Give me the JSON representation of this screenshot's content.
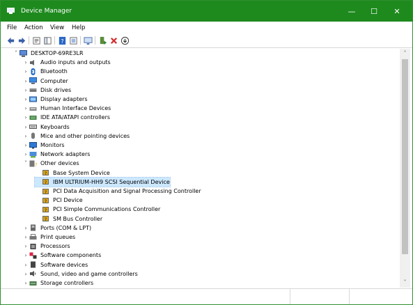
{
  "window": {
    "title": "Device Manager",
    "controls": {
      "minimize": "—",
      "maximize": "☐",
      "close": "✕"
    },
    "accent": "#1e8a1e"
  },
  "menu": [
    "File",
    "Action",
    "View",
    "Help"
  ],
  "toolbar": [
    {
      "name": "back-icon"
    },
    {
      "name": "forward-icon"
    },
    {
      "sep": true
    },
    {
      "name": "properties-icon"
    },
    {
      "name": "show-hide-console-tree-icon"
    },
    {
      "sep": true
    },
    {
      "name": "help-icon"
    },
    {
      "name": "view-icon"
    },
    {
      "sep": true
    },
    {
      "name": "scan-hardware-icon"
    },
    {
      "sep": true
    },
    {
      "name": "update-driver-icon"
    },
    {
      "name": "uninstall-device-icon"
    },
    {
      "name": "download-icon"
    }
  ],
  "tree": {
    "root": "DESKTOP-69RE3LR",
    "items": [
      {
        "label": "Audio inputs and outputs",
        "icon": "speaker-icon"
      },
      {
        "label": "Bluetooth",
        "icon": "bluetooth-icon"
      },
      {
        "label": "Computer",
        "icon": "computer-icon"
      },
      {
        "label": "Disk drives",
        "icon": "disk-drive-icon"
      },
      {
        "label": "Display adapters",
        "icon": "display-adapter-icon"
      },
      {
        "label": "Human Interface Devices",
        "icon": "hid-icon"
      },
      {
        "label": "IDE ATA/ATAPI controllers",
        "icon": "ide-controller-icon"
      },
      {
        "label": "Keyboards",
        "icon": "keyboard-icon"
      },
      {
        "label": "Mice and other pointing devices",
        "icon": "mouse-icon"
      },
      {
        "label": "Monitors",
        "icon": "monitor-icon"
      },
      {
        "label": "Network adapters",
        "icon": "network-adapter-icon"
      },
      {
        "label": "Other devices",
        "icon": "other-devices-icon",
        "expanded": true,
        "children": [
          {
            "label": "Base System Device",
            "icon": "unknown-device-icon"
          },
          {
            "label": "IBM ULTRIUM-HH9 SCSI Sequential Device",
            "icon": "unknown-device-icon",
            "selected": true
          },
          {
            "label": "PCI Data Acquisition and Signal Processing Controller",
            "icon": "unknown-device-icon"
          },
          {
            "label": "PCI Device",
            "icon": "unknown-device-icon"
          },
          {
            "label": "PCI Simple Communications Controller",
            "icon": "unknown-device-icon"
          },
          {
            "label": "SM Bus Controller",
            "icon": "unknown-device-icon"
          }
        ]
      },
      {
        "label": "Ports (COM & LPT)",
        "icon": "port-icon"
      },
      {
        "label": "Print queues",
        "icon": "printer-icon"
      },
      {
        "label": "Processors",
        "icon": "processor-icon"
      },
      {
        "label": "Software components",
        "icon": "software-component-icon"
      },
      {
        "label": "Software devices",
        "icon": "software-device-icon"
      },
      {
        "label": "Sound, video and game controllers",
        "icon": "sound-icon"
      },
      {
        "label": "Storage controllers",
        "icon": "storage-controller-icon"
      }
    ]
  },
  "scroll": {
    "up": "˄",
    "down": "˅"
  },
  "arrows": {
    "collapsed": "›",
    "expanded": "˅"
  },
  "colors": {
    "selection": "#cce8ff",
    "warning": "#e8a400"
  }
}
